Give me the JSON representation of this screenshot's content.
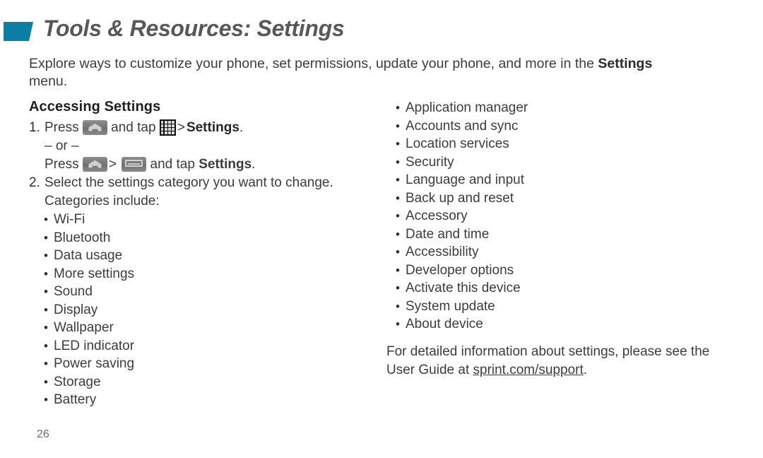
{
  "header": {
    "title": "Tools & Resources: Settings",
    "accent_color": "#0b7ea6",
    "accent_icon": "parallelogram-accent-mark"
  },
  "intro": {
    "line1": "Explore ways to customize your phone, set permissions, update your phone, and more in the",
    "bold_term": "Settings",
    "line2_rest": " menu."
  },
  "main": {
    "section_heading": "Accessing Settings",
    "steps": [
      {
        "number": "1.",
        "prefix": "Press",
        "home_icon": "home-key-icon",
        "middle": "and tap",
        "apps_icon": "apps-grid-icon",
        "separator": ">",
        "target": "Settings",
        "period": "."
      }
    ],
    "or_divider": "– or –",
    "alt_step": {
      "prefix": "Press",
      "home_icon": "home-key-icon",
      "separator": ">",
      "menu_icon": "menu-key-icon",
      "middle": "and tap",
      "target": "Settings",
      "period": "."
    },
    "step2": {
      "number": "2.",
      "text": "Select the settings category you want to change.",
      "subtext": "Categories include:"
    },
    "categories_left": [
      "Wi-Fi",
      "Bluetooth",
      "Data usage",
      "More settings",
      "Sound",
      "Display",
      "Wallpaper",
      "LED indicator",
      "Power saving",
      "Storage",
      "Battery"
    ],
    "categories_right": [
      "Application manager",
      "Accounts and sync",
      "Location services",
      "Security",
      "Language and input",
      "Back up and reset",
      "Accessory",
      "Date and time",
      "Accessibility",
      "Developer options",
      "Activate this device",
      "System update",
      "About device"
    ]
  },
  "note": {
    "line1": "For detailed information about settings, please",
    "line2_prefix": "see the User Guide at ",
    "link": "sprint.com/support",
    "line2_suffix": "."
  },
  "footer": {
    "page_number": "26"
  }
}
